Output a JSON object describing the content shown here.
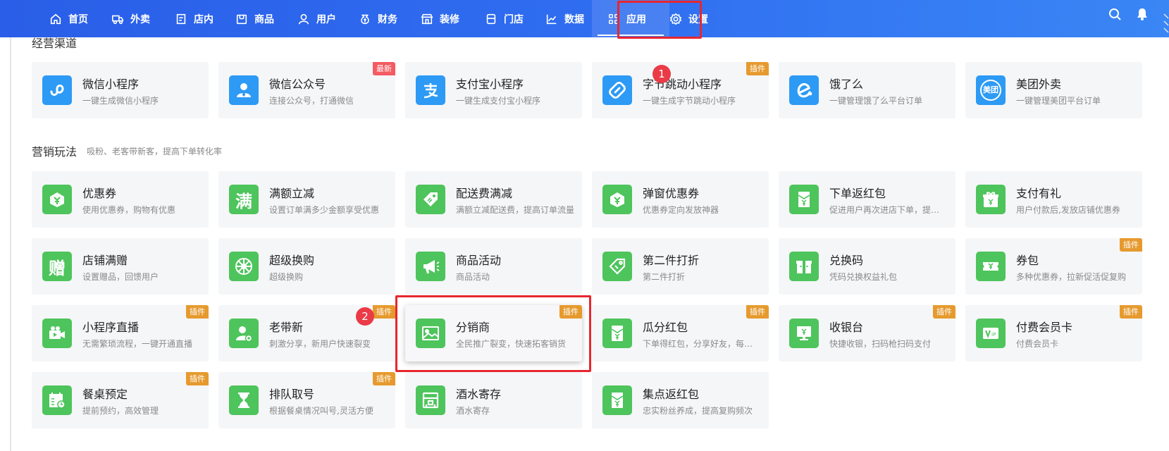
{
  "nav": {
    "items": [
      {
        "label": "首页",
        "icon": "home-icon"
      },
      {
        "label": "外卖",
        "icon": "delivery-icon"
      },
      {
        "label": "店内",
        "icon": "store-in-icon"
      },
      {
        "label": "商品",
        "icon": "goods-icon"
      },
      {
        "label": "用户",
        "icon": "user-icon"
      },
      {
        "label": "财务",
        "icon": "finance-icon"
      },
      {
        "label": "装修",
        "icon": "decoration-icon"
      },
      {
        "label": "门店",
        "icon": "shop-icon"
      },
      {
        "label": "数据",
        "icon": "chart-icon"
      },
      {
        "label": "应用",
        "icon": "apps-icon",
        "active": true
      },
      {
        "label": "设置",
        "icon": "settings-icon"
      }
    ]
  },
  "sections": {
    "channels": {
      "title": "经营渠道"
    },
    "marketing": {
      "title": "营销玩法",
      "subtitle": "吸粉、老客带新客，提高下单转化率"
    }
  },
  "channels": [
    {
      "title": "微信小程序",
      "desc": "一键生成微信小程序",
      "icon": "mini-program-icon"
    },
    {
      "title": "微信公众号",
      "desc": "连接公众号，打通微信",
      "icon": "official-account-icon",
      "tag": "最新"
    },
    {
      "title": "支付宝小程序",
      "desc": "一键生成支付宝小程序",
      "icon": "alipay-icon"
    },
    {
      "title": "字节跳动小程序",
      "desc": "一键生成字节跳动小程序",
      "icon": "bytedance-icon",
      "tag": "插件"
    },
    {
      "title": "饿了么",
      "desc": "一键管理饿了么平台订单",
      "icon": "eleme-icon"
    },
    {
      "title": "美团外卖",
      "desc": "一键管理美团平台订单",
      "icon": "meituan-icon",
      "icon_text": "美团"
    }
  ],
  "marketing": [
    {
      "title": "优惠券",
      "desc": "使用优惠券，购物有优惠",
      "icon": "coupon-icon"
    },
    {
      "title": "满额立减",
      "desc": "设置订单满多少金额享受优惠",
      "icon": "full-reduction-icon",
      "icon_text": "满"
    },
    {
      "title": "配送费满减",
      "desc": "满额立减配送费，提高订单流量",
      "icon": "delivery-fee-tag-icon"
    },
    {
      "title": "弹窗优惠券",
      "desc": "优惠券定向发放神器",
      "icon": "popup-coupon-icon"
    },
    {
      "title": "下单返红包",
      "desc": "促进用户再次进店下单，提升复购率",
      "icon": "red-envelope-icon"
    },
    {
      "title": "支付有礼",
      "desc": "用户付款后,发放店铺优惠券",
      "icon": "pay-gift-icon"
    },
    {
      "title": "店铺满赠",
      "desc": "设置赠品，回馈用户",
      "icon": "gift-icon",
      "icon_text": "赠"
    },
    {
      "title": "超级换购",
      "desc": "超级换购",
      "icon": "wheel-icon"
    },
    {
      "title": "商品活动",
      "desc": "商品活动",
      "icon": "megaphone-icon"
    },
    {
      "title": "第二件打折",
      "desc": "第二件打折",
      "icon": "discount-tag-icon"
    },
    {
      "title": "兑换码",
      "desc": "凭码兑换权益礼包",
      "icon": "redeem-code-icon"
    },
    {
      "title": "券包",
      "desc": "多种优惠券，拉新促活促复购",
      "icon": "coupon-pack-icon",
      "tag": "插件"
    },
    {
      "title": "小程序直播",
      "desc": "无需繁琐流程，一键开通直播",
      "icon": "live-camera-icon",
      "tag": "插件"
    },
    {
      "title": "老带新",
      "desc": "刺激分享，新用户快速裂变",
      "icon": "invite-user-icon",
      "tag": "插件"
    },
    {
      "title": "分销商",
      "desc": "全民推广裂变，快速拓客销货",
      "icon": "image-icon",
      "tag": "插件",
      "highlighted": true
    },
    {
      "title": "瓜分红包",
      "desc": "下单得红包，分享好友，每人领一份",
      "icon": "split-envelope-icon",
      "tag": "插件"
    },
    {
      "title": "收银台",
      "desc": "快捷收银，扫码枪扫码支付",
      "icon": "cashier-icon",
      "tag": "插件"
    },
    {
      "title": "付费会员卡",
      "desc": "付费会员卡",
      "icon": "vip-card-icon",
      "tag": "插件"
    },
    {
      "title": "餐桌预定",
      "desc": "提前预约，高效管理",
      "icon": "calendar-icon",
      "tag": "插件"
    },
    {
      "title": "排队取号",
      "desc": "根据餐桌情况叫号,灵活方便",
      "icon": "hourglass-icon",
      "tag": "插件"
    },
    {
      "title": "酒水寄存",
      "desc": "酒水寄存",
      "icon": "storage-icon"
    },
    {
      "title": "集点返红包",
      "desc": "忠实粉丝养成，提高复购频次",
      "icon": "points-envelope-icon"
    }
  ],
  "annotations": [
    {
      "label": "1"
    },
    {
      "label": "2"
    }
  ],
  "colors": {
    "nav": "#2f6df0",
    "icon_blue": "#2d9af5",
    "icon_green": "#4ec45c",
    "tag": "#e69a2e",
    "tag_new": "#f55b62",
    "highlight": "#e8262f"
  }
}
